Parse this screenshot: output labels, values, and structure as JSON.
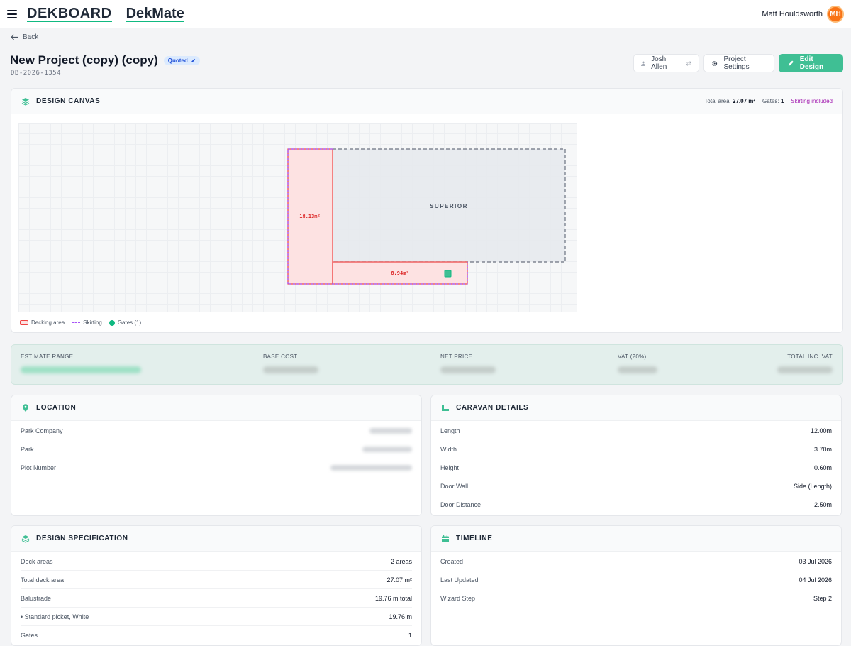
{
  "header": {
    "logo_primary": "DEKBOARD",
    "logo_secondary": "DekMate",
    "user_name": "Matt Houldsworth",
    "user_initials": "MH"
  },
  "page": {
    "back_label": "Back",
    "title": "New Project (copy) (copy)",
    "status_badge": "Quoted",
    "project_code": "DB-2026-1354"
  },
  "actions": {
    "assignee": "Josh Allen",
    "settings_label": "Project Settings",
    "edit_label": "Edit Design"
  },
  "canvas": {
    "title": "DESIGN CANVAS",
    "total_area_label": "Total area:",
    "total_area_value": "27.07 m²",
    "gates_label": "Gates:",
    "gates_value": "1",
    "skirting_label": "Skirting included",
    "caravan_label": "SUPERIOR",
    "area1_label": "18.13m²",
    "area2_label": "8.94m²",
    "legend": {
      "decking": "Decking area",
      "skirting": "Skirting",
      "gates": "Gates (1)"
    }
  },
  "estimate": {
    "range_label": "ESTIMATE RANGE",
    "base_cost_label": "BASE COST",
    "net_price_label": "NET PRICE",
    "vat_label": "VAT (20%)",
    "total_label": "TOTAL INC. VAT"
  },
  "location": {
    "title": "LOCATION",
    "rows": [
      {
        "label": "Park Company"
      },
      {
        "label": "Park"
      },
      {
        "label": "Plot Number"
      }
    ]
  },
  "caravan": {
    "title": "CARAVAN DETAILS",
    "rows": [
      {
        "label": "Length",
        "value": "12.00m"
      },
      {
        "label": "Width",
        "value": "3.70m"
      },
      {
        "label": "Height",
        "value": "0.60m"
      },
      {
        "label": "Door Wall",
        "value": "Side (Length)"
      },
      {
        "label": "Door Distance",
        "value": "2.50m"
      }
    ]
  },
  "spec": {
    "title": "DESIGN SPECIFICATION",
    "rows": [
      {
        "label": "Deck areas",
        "value": "2 areas"
      },
      {
        "label": "Total deck area",
        "value": "27.07 m²"
      },
      {
        "label": "Balustrade",
        "value": "19.76 m total"
      },
      {
        "label": "• Standard picket, White",
        "value": "19.76 m"
      },
      {
        "label": "Gates",
        "value": "1"
      }
    ]
  },
  "timeline": {
    "title": "TIMELINE",
    "rows": [
      {
        "label": "Created",
        "value": "03 Jul 2026"
      },
      {
        "label": "Last Updated",
        "value": "04 Jul 2026"
      },
      {
        "label": "Wizard Step",
        "value": "Step 2"
      }
    ]
  },
  "colors": {
    "accent": "#3fbf94",
    "deck_fill": "#fde2e2",
    "deck_stroke": "#ef4444",
    "skirting": "#a855f7",
    "gate": "#10b981"
  }
}
